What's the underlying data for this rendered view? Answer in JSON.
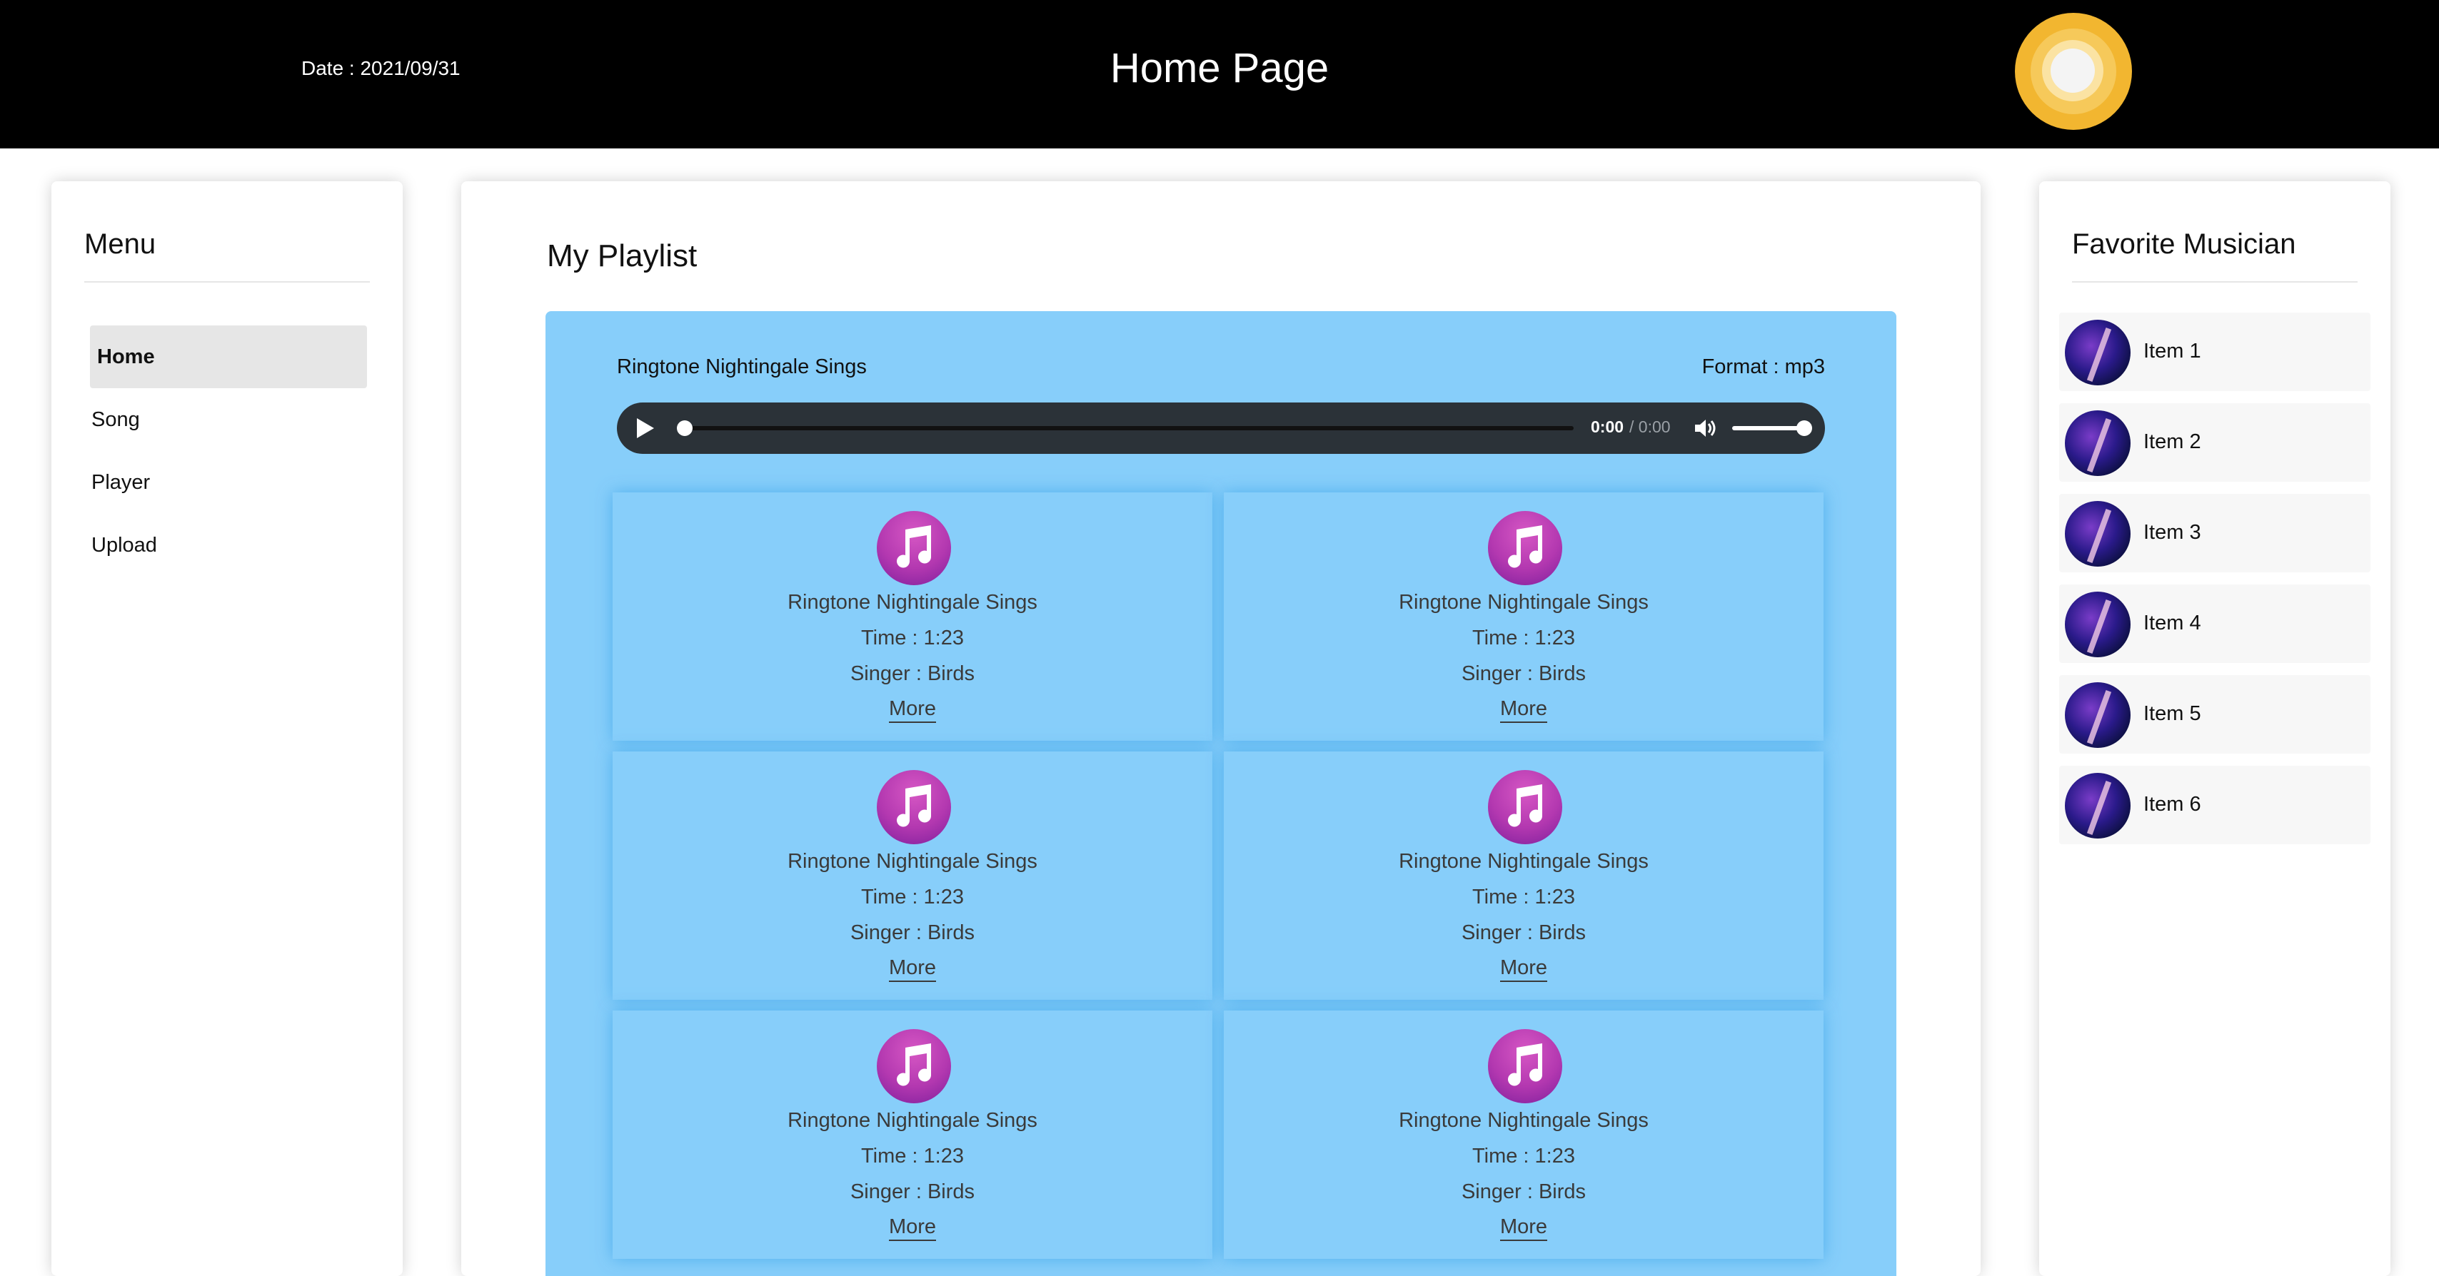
{
  "header": {
    "date": "Date : 2021/09/31",
    "title": "Home Page",
    "logo_icon": "sun-logo-icon"
  },
  "menu": {
    "heading": "Menu",
    "items": [
      {
        "label": "Home",
        "active": true
      },
      {
        "label": "Song",
        "active": false
      },
      {
        "label": "Player",
        "active": false
      },
      {
        "label": "Upload",
        "active": false
      }
    ]
  },
  "playlist": {
    "heading": "My Playlist",
    "now_playing": {
      "name": "Ringtone Nightingale Sings",
      "format": "Format : mp3",
      "current_time": "0:00",
      "duration": "/ 0:00",
      "progress": 0,
      "volume": 1.0
    },
    "cards": [
      {
        "title": "Ringtone Nightingale Sings",
        "time": "Time : 1:23",
        "singer": "Singer : Birds",
        "more": "More"
      },
      {
        "title": "Ringtone Nightingale Sings",
        "time": "Time : 1:23",
        "singer": "Singer : Birds",
        "more": "More"
      },
      {
        "title": "Ringtone Nightingale Sings",
        "time": "Time : 1:23",
        "singer": "Singer : Birds",
        "more": "More"
      },
      {
        "title": "Ringtone Nightingale Sings",
        "time": "Time : 1:23",
        "singer": "Singer : Birds",
        "more": "More"
      },
      {
        "title": "Ringtone Nightingale Sings",
        "time": "Time : 1:23",
        "singer": "Singer : Birds",
        "more": "More"
      },
      {
        "title": "Ringtone Nightingale Sings",
        "time": "Time : 1:23",
        "singer": "Singer : Birds",
        "more": "More"
      }
    ]
  },
  "favorites": {
    "heading": "Favorite Musician",
    "items": [
      {
        "label": "Item 1"
      },
      {
        "label": "Item 2"
      },
      {
        "label": "Item 3"
      },
      {
        "label": "Item 4"
      },
      {
        "label": "Item 5"
      },
      {
        "label": "Item 6"
      }
    ]
  },
  "colors": {
    "header_bg": "#000000",
    "player_bg": "#87cefa",
    "audio_bar": "#2b3238",
    "note_icon": "#b338b0",
    "logo": "#f2b630"
  }
}
